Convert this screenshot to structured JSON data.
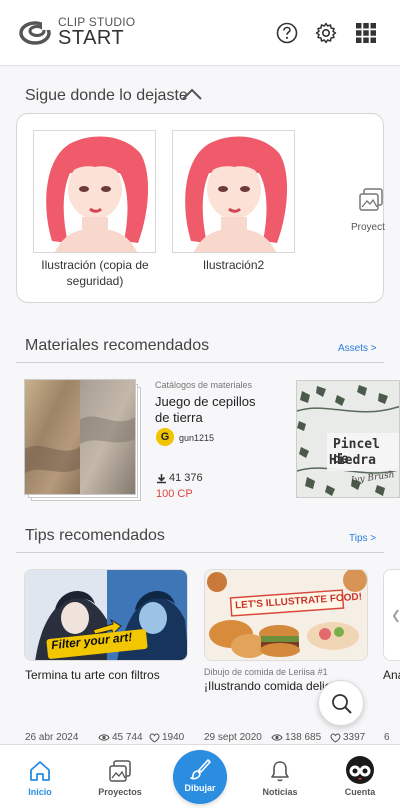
{
  "header": {
    "logo_line1": "CLIP STUDIO",
    "logo_line2": "START",
    "icons": [
      "help-icon",
      "settings-gear-icon",
      "apps-grid-icon"
    ]
  },
  "continue_section": {
    "title": "Sigue donde lo dejaste",
    "items": [
      {
        "label": "Ilustración (copia de seguridad)"
      },
      {
        "label": "Ilustración2"
      }
    ],
    "partial_label": "Proyect"
  },
  "materials_section": {
    "title": "Materiales recomendados",
    "link": "Assets >",
    "item": {
      "category": "Catálogos de materiales",
      "title": "Juego de cepillos de tierra",
      "author_initial": "G",
      "author": "gun1215",
      "downloads": "41 376",
      "price": "100 CP"
    },
    "partial_item_text_1": "Pincel de",
    "partial_item_text_2": "Hiedra",
    "partial_item_text_3": "Ivy Brush"
  },
  "tips_section": {
    "title": "Tips recomendados",
    "link": "Tips >",
    "cards": [
      {
        "banner": "Filter your art!",
        "title": "Termina tu arte con filtros",
        "subtitle": "",
        "date": "26 abr 2024",
        "views": "45 744",
        "likes": "1940"
      },
      {
        "banner": "LET'S ILLUSTRATE FOOD!",
        "subtitle": "Dibujo de comida de Leriisa #1",
        "title": "¡Ilustrando comida deliciosa!",
        "date": "29 sept 2020",
        "views": "138 685",
        "likes": "3397"
      }
    ],
    "partial_title": "Ana",
    "partial_date": "6"
  },
  "bottom_nav": {
    "items": [
      {
        "label": "Inicio",
        "icon": "home-icon"
      },
      {
        "label": "Proyectos",
        "icon": "projects-icon"
      },
      {
        "label": "Dibujar",
        "icon": "brush-icon"
      },
      {
        "label": "Noticias",
        "icon": "bell-icon"
      },
      {
        "label": "Cuenta",
        "icon": "avatar"
      }
    ]
  },
  "colors": {
    "accent": "#2a8de0",
    "link": "#2a7de1",
    "price": "#e0443a"
  }
}
